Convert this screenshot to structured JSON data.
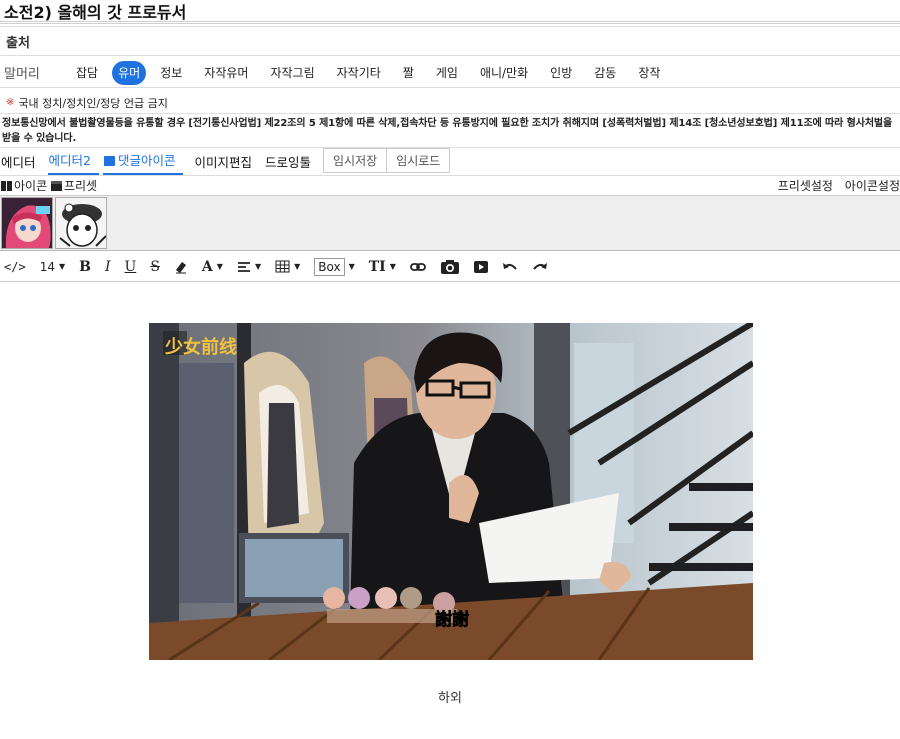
{
  "post": {
    "title": "소전2) 올해의 갓 프로듀서"
  },
  "source": {
    "label": "출처"
  },
  "categories": {
    "label": "말머리",
    "items": [
      "잡담",
      "유머",
      "정보",
      "자작유머",
      "자작그림",
      "자작기타",
      "짤",
      "게임",
      "애니/만화",
      "인방",
      "감동",
      "장작"
    ],
    "active": "유머"
  },
  "notice": {
    "text": "국내 정치/정치인/정당 언급 금지"
  },
  "legal": {
    "text": "정보통신망에서 불법촬영물등을 유통할 경우 [전기통신사업법] 제22조의 5 제1항에 따른 삭제,접속차단 등 유통방지에 필요한 조치가 취해지며 [성폭력처벌법] 제14조 [청소년성보호법] 제11조에 따라 형사처벌을 받을 수 있습니다."
  },
  "editor_tabs": {
    "editor": "에디터",
    "editor2": "에디터2",
    "comment_icon": "댓글아이콘",
    "image_edit": "이미지편집",
    "drawing": "드로잉툴",
    "temp_save": "임시저장",
    "temp_load": "임시로드"
  },
  "icon_panel": {
    "icon_label": "아이콘",
    "preset_label": "프리셋",
    "preset_settings": "프리셋설정",
    "icon_settings": "아이콘설정"
  },
  "toolbar": {
    "code_view": "</>",
    "font_size": "14",
    "bold": "B",
    "italic": "I",
    "underline": "U",
    "strike": "S",
    "font_color": "A",
    "box": "Box",
    "text_size": "TI"
  },
  "content": {
    "subtitle_text": "謝謝",
    "logo_text": "少女前线",
    "caption": "하외"
  },
  "colors": {
    "accent": "#1e73e0",
    "notice_red": "#dd3333"
  }
}
